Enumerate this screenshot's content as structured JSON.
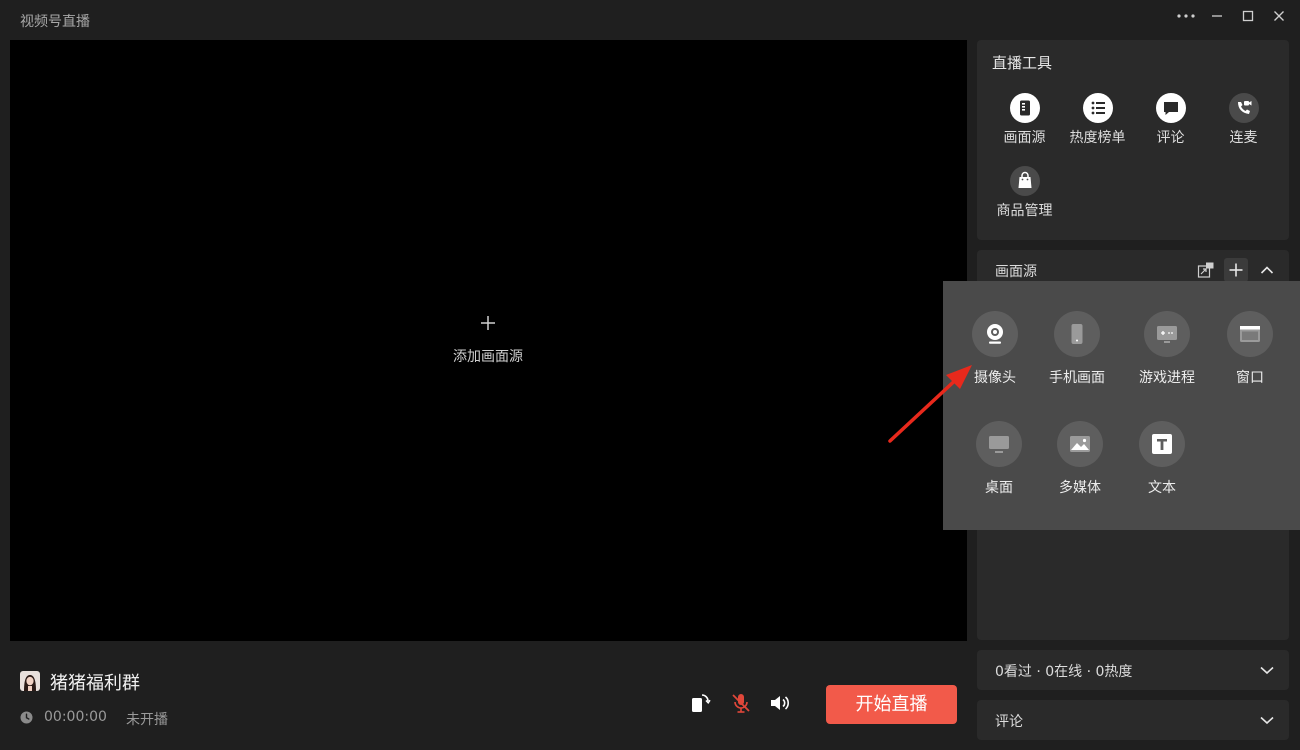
{
  "window": {
    "title": "视频号直播"
  },
  "preview": {
    "add_source_label": "添加画面源"
  },
  "bottom": {
    "channel_name": "猪猪福利群",
    "timer": "00:00:00",
    "status": "未开播",
    "start_button": "开始直播"
  },
  "tools": {
    "title": "直播工具",
    "items": [
      {
        "label": "画面源",
        "icon": "screen-source-icon"
      },
      {
        "label": "热度榜单",
        "icon": "list-icon"
      },
      {
        "label": "评论",
        "icon": "comment-icon"
      },
      {
        "label": "连麦",
        "icon": "phone-video-icon"
      },
      {
        "label": "商品管理",
        "icon": "shopping-bag-icon"
      }
    ]
  },
  "source_panel": {
    "title": "画面源"
  },
  "source_menu": {
    "items": [
      {
        "label": "摄像头",
        "icon": "camera-icon"
      },
      {
        "label": "手机画面",
        "icon": "phone-icon"
      },
      {
        "label": "游戏进程",
        "icon": "game-icon"
      },
      {
        "label": "窗口",
        "icon": "window-icon"
      },
      {
        "label": "桌面",
        "icon": "desktop-icon"
      },
      {
        "label": "多媒体",
        "icon": "image-icon"
      },
      {
        "label": "文本",
        "icon": "text-icon"
      }
    ]
  },
  "stats": {
    "label": "0看过 · 0在线 · 0热度"
  },
  "comments": {
    "label": "评论"
  },
  "colors": {
    "accent": "#f25a4a",
    "annotation_arrow": "#e8291c",
    "mic_muted": "#e0473a"
  }
}
